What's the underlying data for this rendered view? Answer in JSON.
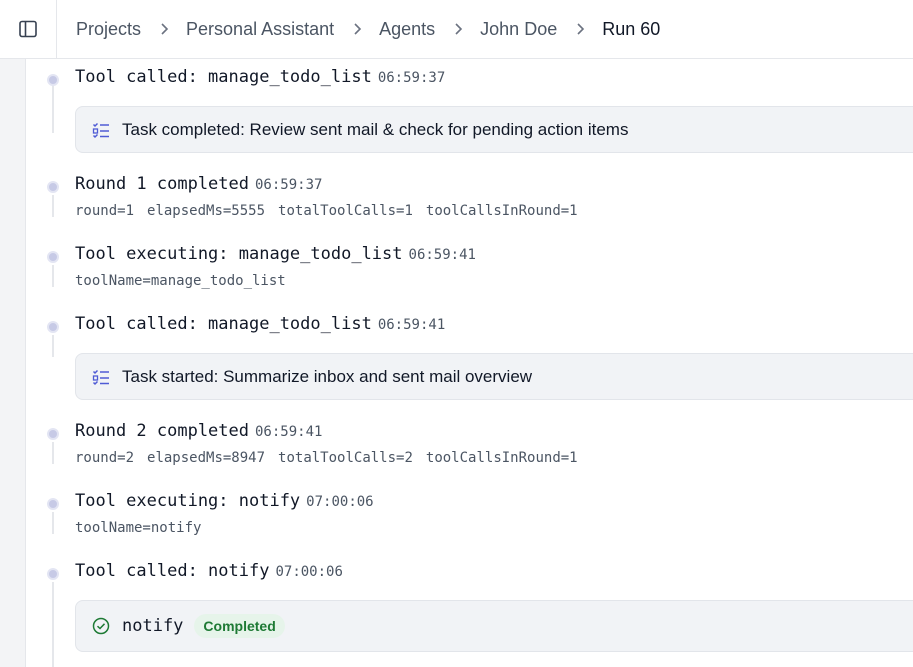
{
  "header": {
    "breadcrumb": [
      "Projects",
      "Personal Assistant",
      "Agents",
      "John Doe",
      "Run 60"
    ]
  },
  "events": [
    {
      "title": "Tool called: manage_todo_list",
      "time": "06:59:37"
    },
    {
      "card_text": "Task completed: Review sent mail & check for pending action items"
    },
    {
      "title": "Round 1 completed",
      "time": "06:59:37",
      "meta": [
        "round=1",
        "elapsedMs=5555",
        "totalToolCalls=1",
        "toolCallsInRound=1"
      ]
    },
    {
      "title": "Tool executing: manage_todo_list",
      "time": "06:59:41",
      "meta": [
        "toolName=manage_todo_list"
      ]
    },
    {
      "title": "Tool called: manage_todo_list",
      "time": "06:59:41"
    },
    {
      "card_text": "Task started: Summarize inbox and sent mail overview"
    },
    {
      "title": "Round 2 completed",
      "time": "06:59:41",
      "meta": [
        "round=2",
        "elapsedMs=8947",
        "totalToolCalls=2",
        "toolCallsInRound=1"
      ]
    },
    {
      "title": "Tool executing: notify",
      "time": "07:00:06",
      "meta": [
        "toolName=notify"
      ]
    },
    {
      "title": "Tool called: notify",
      "time": "07:00:06"
    },
    {
      "card_label": "notify",
      "badge": "Completed"
    }
  ],
  "colors": {
    "accent": "#4f5bd5",
    "success": "#1e7a35"
  }
}
